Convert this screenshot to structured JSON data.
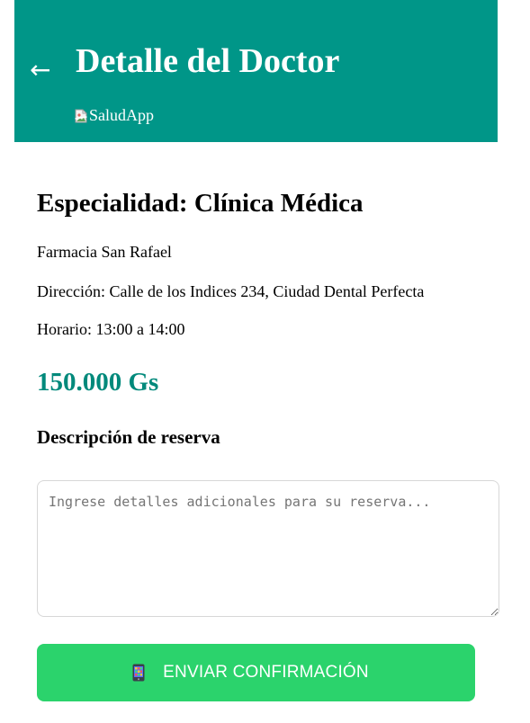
{
  "colors": {
    "header_bg": "#009688",
    "price": "#00897b",
    "button_bg": "#2bd36c",
    "button_text": "#ffffff"
  },
  "header": {
    "back_symbol": "←",
    "back_icon": "left-arrow-icon",
    "title": "Detalle del Doctor",
    "logo_alt": "SaludApp",
    "logo_icon": "broken-image-icon"
  },
  "doctor": {
    "specialty": "Especialidad: Clínica Médica",
    "pharmacy": "Farmacia San Rafael",
    "address": "Dirección: Calle de los Indices 234, Ciudad Dental Perfecta",
    "schedule": "Horario: 13:00 a 14:00",
    "price": "150.000 Gs"
  },
  "reservation": {
    "heading": "Descripción de reserva",
    "textarea_value": "",
    "textarea_placeholder": "Ingrese detalles adicionales para su reserva...",
    "button_label": "ENVIAR CONFIRMACIÓN",
    "button_icon": "mobile-phone-icon"
  }
}
